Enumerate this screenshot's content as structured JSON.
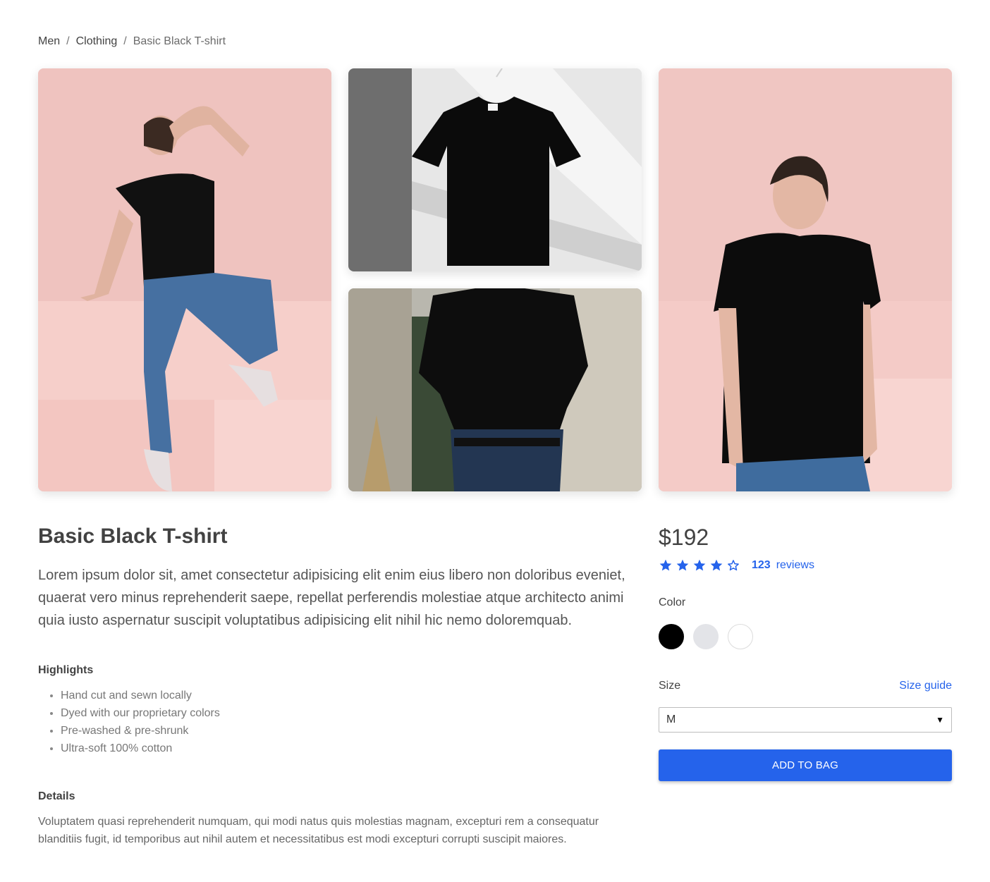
{
  "breadcrumb": {
    "items": [
      "Men",
      "Clothing"
    ],
    "current": "Basic Black T-shirt",
    "separator": "/"
  },
  "gallery": {
    "images": [
      "woman-sitting-photo",
      "hanging-shirt-photo",
      "shirt-closeup-photo",
      "woman-looking-down-photo"
    ]
  },
  "product": {
    "title": "Basic Black T-shirt",
    "description": "Lorem ipsum dolor sit, amet consectetur adipisicing elit enim eius libero non doloribus eveniet, quaerat vero minus reprehenderit saepe, repellat perferendis molestiae atque architecto animi quia iusto aspernatur suscipit voluptatibus adipisicing elit nihil hic nemo doloremquab.",
    "highlights_heading": "Highlights",
    "highlights": [
      "Hand cut and sewn locally",
      "Dyed with our proprietary colors",
      "Pre-washed & pre-shrunk",
      "Ultra-soft 100% cotton"
    ],
    "details_heading": "Details",
    "details": "Voluptatem quasi reprehenderit numquam, qui modi natus quis molestias magnam, excepturi rem a consequatur blanditiis fugit, id temporibus aut nihil autem et necessitatibus est modi excepturi corrupti suscipit maiores."
  },
  "purchase": {
    "price": "$192",
    "rating": 4,
    "rating_max": 5,
    "reviews_count": "123",
    "reviews_label": "reviews",
    "color_label": "Color",
    "colors": [
      "#000000",
      "#e3e4e8",
      "#ffffff"
    ],
    "size_label": "Size",
    "size_guide": "Size guide",
    "size_value": "M",
    "add_button": "ADD TO BAG"
  },
  "colors": {
    "accent": "#2563eb",
    "text": "#424242"
  }
}
